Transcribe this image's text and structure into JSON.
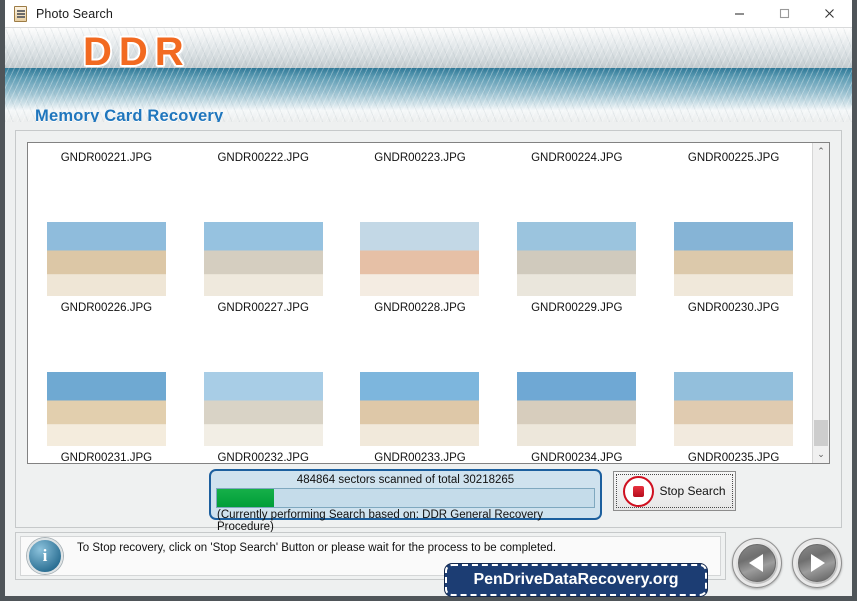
{
  "window": {
    "title": "Photo Search",
    "icon": "memory-card-document-icon",
    "minimize_label": "—",
    "maximize_label": "□",
    "close_label": "✕"
  },
  "header": {
    "logo": "DDR",
    "product_name": "Memory Card Recovery",
    "logo_color": "#f26a21",
    "product_name_color": "#1f76bd"
  },
  "file_list": {
    "rows": [
      {
        "partial": true,
        "items": [
          {
            "name": "GNDR00221.JPG"
          },
          {
            "name": "GNDR00222.JPG"
          },
          {
            "name": "GNDR00223.JPG"
          },
          {
            "name": "GNDR00224.JPG"
          },
          {
            "name": "GNDR00225.JPG"
          }
        ]
      },
      {
        "partial": false,
        "items": [
          {
            "name": "GNDR00226.JPG"
          },
          {
            "name": "GNDR00227.JPG"
          },
          {
            "name": "GNDR00228.JPG"
          },
          {
            "name": "GNDR00229.JPG"
          },
          {
            "name": "GNDR00230.JPG"
          }
        ]
      },
      {
        "partial": false,
        "items": [
          {
            "name": "GNDR00231.JPG"
          },
          {
            "name": "GNDR00232.JPG"
          },
          {
            "name": "GNDR00233.JPG"
          },
          {
            "name": "GNDR00234.JPG"
          },
          {
            "name": "GNDR00235.JPG"
          }
        ]
      }
    ],
    "scrollbar": {
      "up_arrow": "⌃",
      "down_arrow": "⌄"
    }
  },
  "progress": {
    "sectors_text": "484864 sectors scanned of total 30218265",
    "sectors_scanned": 484864,
    "sectors_total": 30218265,
    "percent": 15,
    "procedure_text": "(Currently performing Search based on:  DDR General Recovery Procedure)",
    "fill_color": "#00a840",
    "border_color": "#1c5f9e"
  },
  "stop_button": {
    "label": "Stop Search",
    "icon": "stop-square-icon",
    "icon_color": "#cf1020"
  },
  "status": {
    "icon": "info-icon",
    "icon_glyph": "i",
    "message": "To Stop recovery, click on 'Stop Search' Button or please wait for the process to be completed."
  },
  "site_badge": {
    "label": "PenDriveDataRecovery.org",
    "background": "#1c3d73"
  },
  "navigation": {
    "back_label": "back-arrow-icon",
    "next_label": "forward-arrow-icon"
  }
}
